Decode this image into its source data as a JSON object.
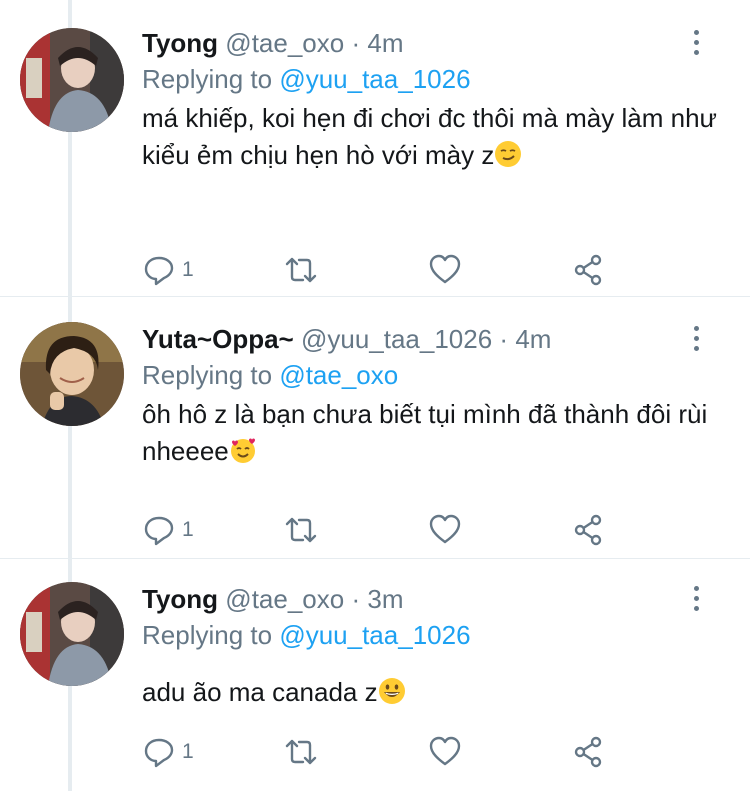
{
  "tweets": [
    {
      "name": "Tyong",
      "handle": "@tae_oxo",
      "separator": "·",
      "time": "4m",
      "replying_prefix": "Replying to",
      "replying_to": "@yuu_taa_1026",
      "text": "má khiếp, koi hẹn đi chơi đc thôi mà mày làm như kiểu ẻm chịu hẹn hò với mày z",
      "emoji": "smirking-face",
      "reply_count": "1",
      "avatar_color": "#6b5b52"
    },
    {
      "name": "Yuta~Oppa~",
      "handle": "@yuu_taa_1026",
      "separator": "·",
      "time": "4m",
      "replying_prefix": "Replying to",
      "replying_to": "@tae_oxo",
      "text": "ôh hô z là bạn chưa biết tụi mình đã thành đôi rùi nheeee",
      "emoji": "smiling-face-with-hearts",
      "reply_count": "1",
      "avatar_color": "#8a6a3a"
    },
    {
      "name": "Tyong",
      "handle": "@tae_oxo",
      "separator": "·",
      "time": "3m",
      "replying_prefix": "Replying to",
      "replying_to": "@yuu_taa_1026",
      "text": "adu ão ma canada z",
      "emoji": "grinning-face",
      "reply_count": "1",
      "avatar_color": "#6b5b52"
    }
  ],
  "colors": {
    "accent": "#1da1f2",
    "secondary_text": "#657786",
    "divider": "#e6ecf0"
  },
  "icons": [
    "reply-icon",
    "retweet-icon",
    "like-icon",
    "share-icon",
    "more-icon"
  ]
}
